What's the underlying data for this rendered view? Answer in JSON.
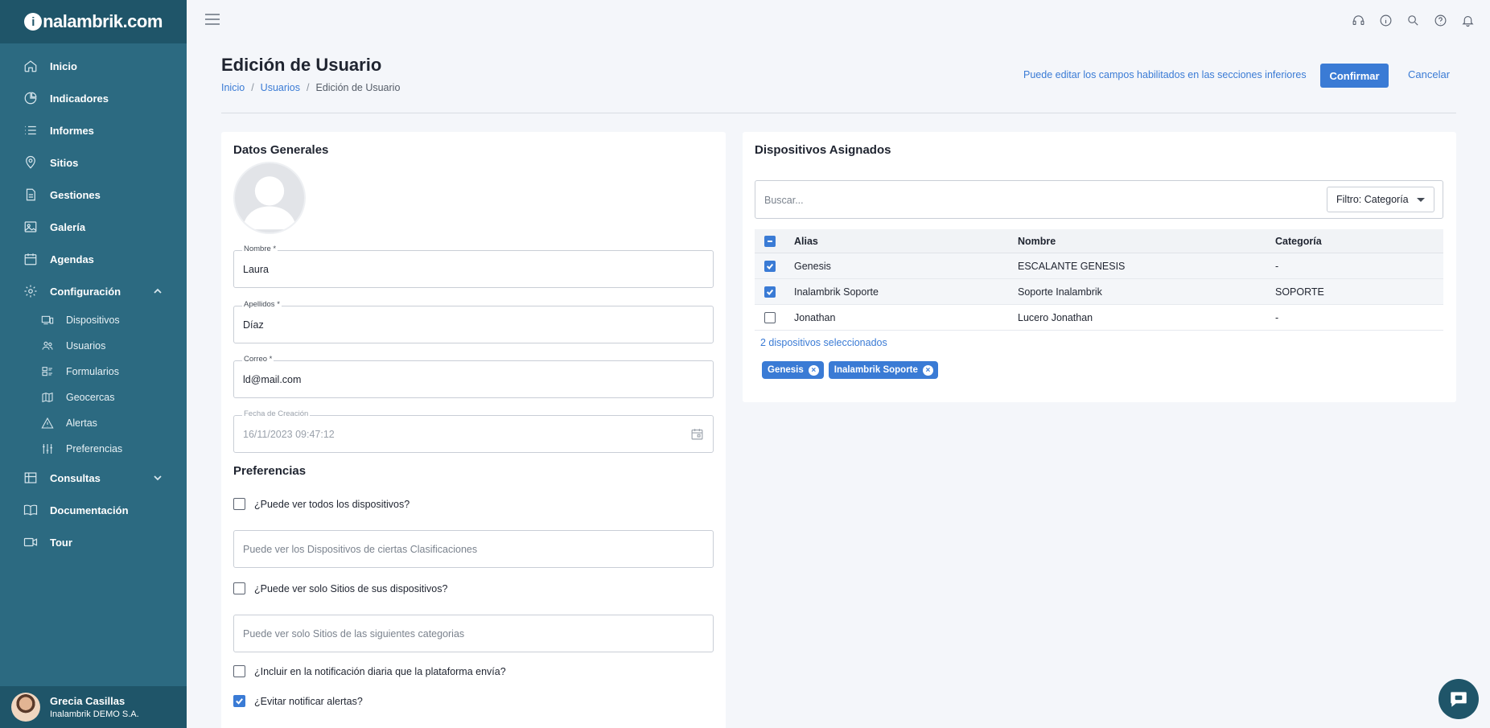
{
  "brand": {
    "prefix": "i",
    "rest": "nalambrik.com"
  },
  "sidebar": {
    "items": [
      {
        "label": "Inicio",
        "icon": "home-icon"
      },
      {
        "label": "Indicadores",
        "icon": "pie-chart-icon"
      },
      {
        "label": "Informes",
        "icon": "list-icon"
      },
      {
        "label": "Sitios",
        "icon": "map-pin-icon"
      },
      {
        "label": "Gestiones",
        "icon": "document-icon"
      },
      {
        "label": "Galería",
        "icon": "image-icon"
      },
      {
        "label": "Agendas",
        "icon": "calendar-icon"
      },
      {
        "label": "Configuración",
        "icon": "gear-icon"
      }
    ],
    "config_sub": [
      {
        "label": "Dispositivos",
        "icon": "devices-icon"
      },
      {
        "label": "Usuarios",
        "icon": "users-icon"
      },
      {
        "label": "Formularios",
        "icon": "form-icon"
      },
      {
        "label": "Geocercas",
        "icon": "map-icon"
      },
      {
        "label": "Alertas",
        "icon": "warning-icon"
      },
      {
        "label": "Preferencias",
        "icon": "sliders-icon"
      }
    ],
    "lower": [
      {
        "label": "Consultas",
        "icon": "table-icon"
      },
      {
        "label": "Documentación",
        "icon": "book-icon"
      },
      {
        "label": "Tour",
        "icon": "video-icon"
      }
    ],
    "user": {
      "name": "Grecia Casillas",
      "org": "Inalambrik DEMO S.A."
    }
  },
  "header": {
    "title": "Edición de Usuario",
    "breadcrumb": [
      "Inicio",
      "Usuarios",
      "Edición de Usuario"
    ],
    "hint": "Puede editar los campos habilitados en las secciones inferiores",
    "confirm_label": "Confirmar",
    "cancel_label": "Cancelar"
  },
  "general": {
    "title": "Datos Generales",
    "nombre": {
      "label": "Nombre *",
      "value": "Laura"
    },
    "apellidos": {
      "label": "Apellidos *",
      "value": "Díaz"
    },
    "correo": {
      "label": "Correo *",
      "value": "ld@mail.com"
    },
    "fecha": {
      "label": "Fecha de Creación",
      "value": "16/11/2023 09:47:12"
    }
  },
  "prefs": {
    "title": "Preferencias",
    "ver_todos": "¿Puede ver todos los dispositivos?",
    "clasif_placeholder": "Puede ver los Dispositivos de ciertas Clasificaciones",
    "ver_sitios": "¿Puede ver solo Sitios de sus dispositivos?",
    "sitios_placeholder": "Puede ver solo Sitios de las siguientes categorias",
    "notif_diaria": "¿Incluir en la notificación diaria que la plataforma envía?",
    "evitar_alertas": "¿Evitar notificar alertas?"
  },
  "devices": {
    "title": "Dispositivos Asignados",
    "search_placeholder": "Buscar...",
    "filter_label": "Filtro: Categoría",
    "columns": [
      "Alias",
      "Nombre",
      "Categoría"
    ],
    "rows": [
      {
        "alias": "Genesis",
        "nombre": "ESCALANTE GENESIS",
        "categoria": "-",
        "checked": true
      },
      {
        "alias": "Inalambrik Soporte",
        "nombre": "Soporte Inalambrik",
        "categoria": "SOPORTE",
        "checked": true
      },
      {
        "alias": "Jonathan",
        "nombre": "Lucero Jonathan",
        "categoria": "-",
        "checked": false
      }
    ],
    "selected_count": "2 dispositivos seleccionados",
    "chips": [
      "Genesis",
      "Inalambrik Soporte"
    ]
  },
  "colors": {
    "sidebar": "#2c6a81",
    "sidebar_dark": "#1f5569",
    "accent": "#3a7bd5"
  }
}
